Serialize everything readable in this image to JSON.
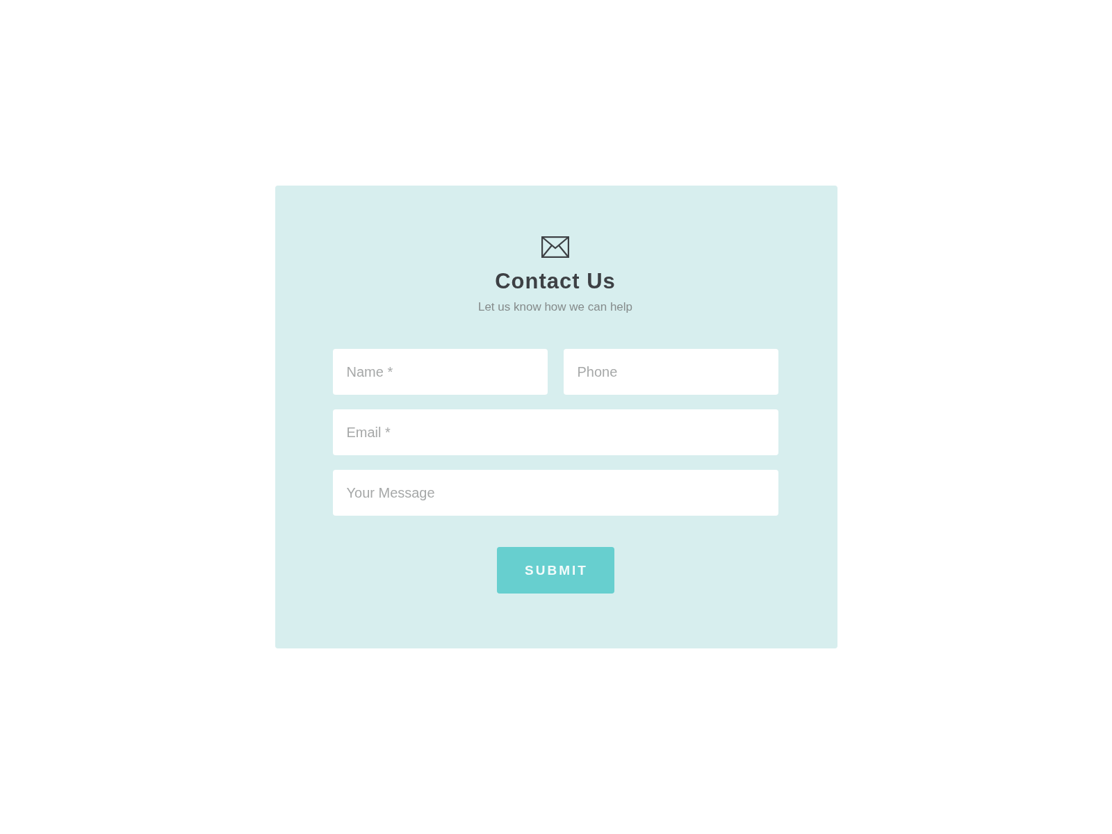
{
  "header": {
    "title": "Contact Us",
    "subtitle": "Let us know how we can help"
  },
  "fields": [
    {
      "kind": "half",
      "placeholder": "Name *"
    },
    {
      "kind": "half",
      "placeholder": "Phone"
    },
    {
      "kind": "full",
      "placeholder": "Email *"
    },
    {
      "kind": "full",
      "placeholder": "Your Message"
    }
  ],
  "submit": {
    "label": "SUBMIT"
  }
}
